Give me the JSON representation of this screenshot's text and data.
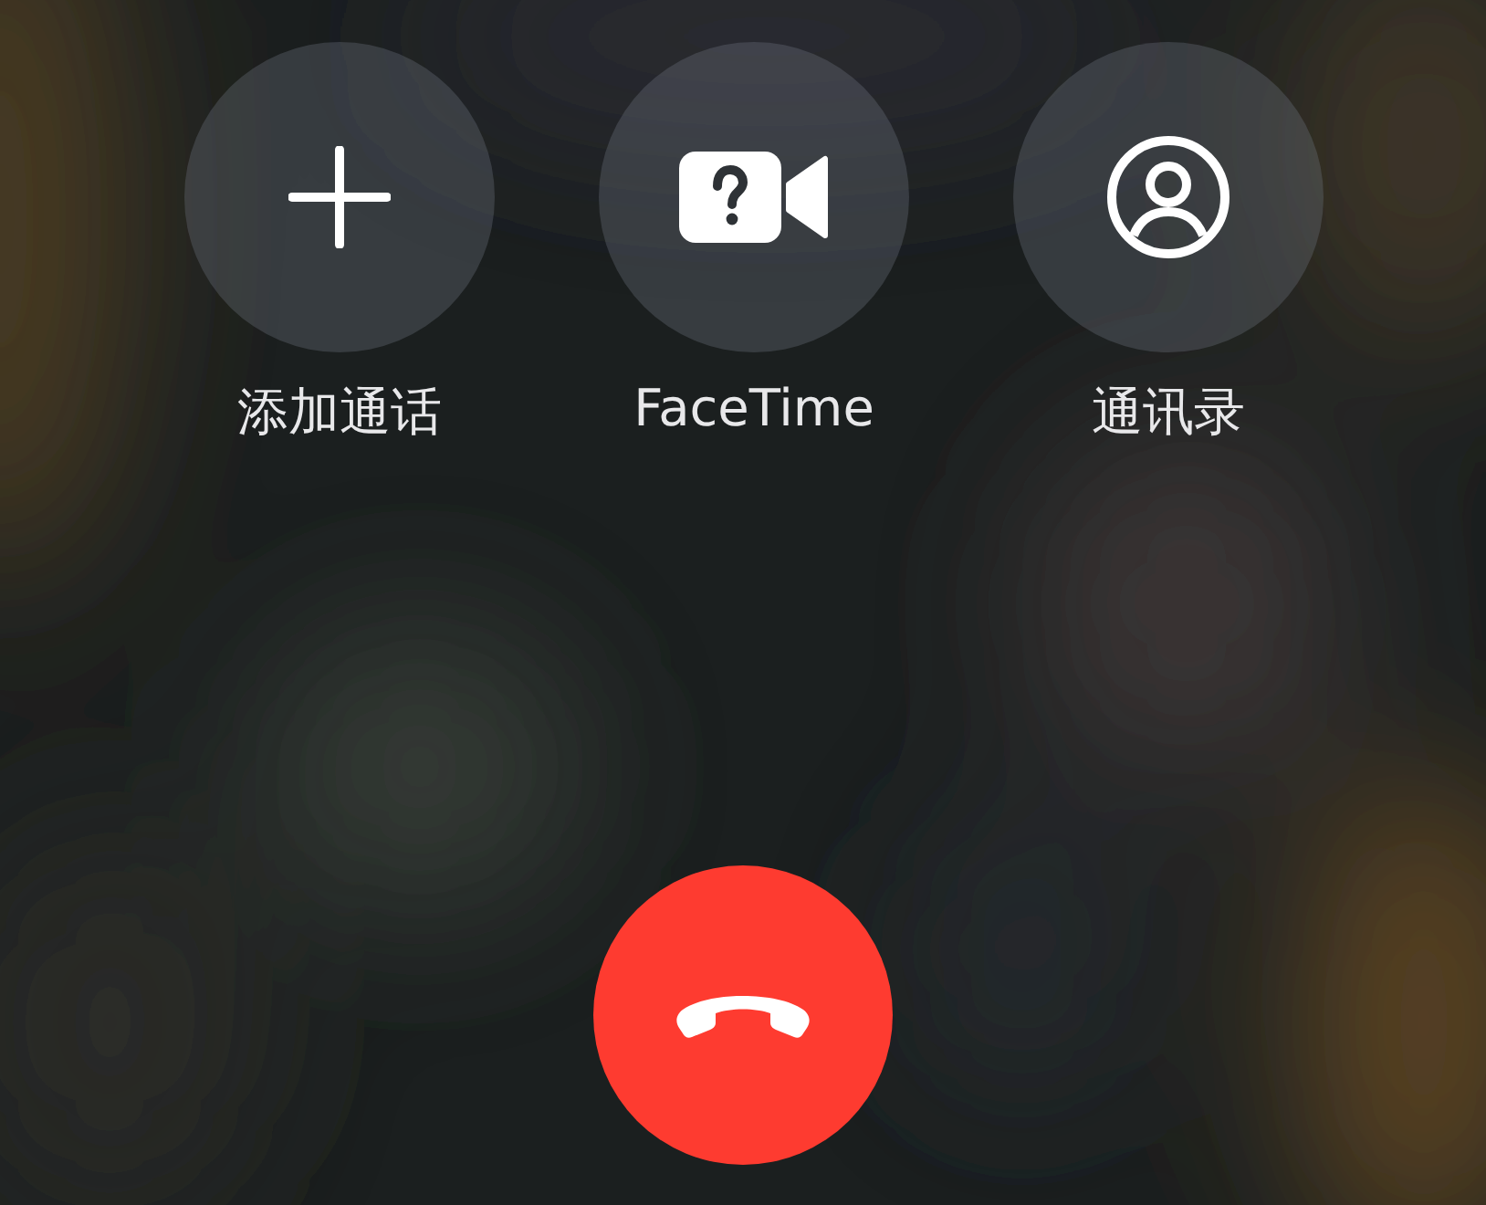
{
  "actions": [
    {
      "kind": "add",
      "label": "添加通话"
    },
    {
      "kind": "facetime",
      "label": "FaceTime"
    },
    {
      "kind": "contacts",
      "label": "通讯录"
    }
  ]
}
